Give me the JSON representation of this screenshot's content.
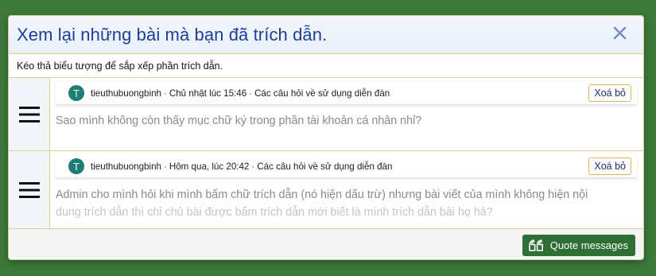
{
  "modal": {
    "title": "Xem lại những bài mà bạn đã trích dẫn.",
    "close_icon": "close-icon",
    "hint": "Kéo thả biểu tượng để sắp xếp phần trích dẫn."
  },
  "quotes": [
    {
      "avatar_letter": "T",
      "author": "tieuthubuongbinh",
      "time": "Chủ nhật lúc 15:46",
      "forum": "Các câu hỏi về sử dụng diễn đàn",
      "remove_label": "Xoá bỏ",
      "text_line1": "Sao mình không còn thấy mục chữ ký trong phần tài khoản cá nhân nhỉ?"
    },
    {
      "avatar_letter": "T",
      "author": "tieuthubuongbinh",
      "time": "Hôm qua, lúc 20:42",
      "forum": "Các câu hỏi về sử dụng diễn đàn",
      "remove_label": "Xoá bỏ",
      "text_line1": "Admin cho mình hỏi khi mình bấm chữ trích dẫn (nó hiện dấu trừ) nhưng bài viết của mình không hiện nội",
      "text_line2": "dung trích dẫn thì chỉ chủ bài được bấm trích dẫn mới biết là mình trích dẫn bài họ hả?"
    }
  ],
  "footer": {
    "quote_button_label": "Quote messages",
    "quote_icon": "quote-icon"
  },
  "colors": {
    "page_background": "#3d7a3a",
    "title": "#1c3f9b",
    "button": "#2f6e35",
    "avatar": "#1e7d74"
  },
  "icons": {
    "drag_handle": "hamburger-drag-icon",
    "separator": "·"
  }
}
